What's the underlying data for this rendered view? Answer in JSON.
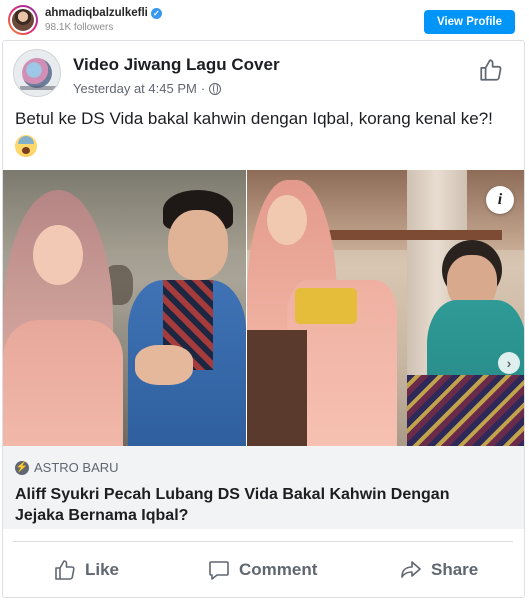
{
  "profile": {
    "username": "ahmadiqbalzulkefli",
    "followers": "98.1K followers",
    "view_profile_label": "View Profile"
  },
  "post": {
    "page_name": "Video Jiwang Lagu Cover",
    "timestamp": "Yesterday at 4:45 PM",
    "separator": "·",
    "text": "Betul ke DS Vida bakal kahwin dengan Iqbal, korang kenal ke?!"
  },
  "link": {
    "source": "ASTRO BARU",
    "headline": "Aliff Syukri Pecah Lubang DS Vida Bakal Kahwin Dengan Jejaka Bernama Iqbal?"
  },
  "actions": {
    "like": "Like",
    "comment": "Comment",
    "share": "Share"
  },
  "icons": {
    "verified": "verified-badge-icon",
    "globe": "globe-icon",
    "thumbs_up": "thumbs-up-icon",
    "info": "info-icon",
    "next": "chevron-right-icon",
    "bolt": "bolt-icon",
    "comment": "comment-icon",
    "share": "share-arrow-icon",
    "emoji": "fearful-face-emoji"
  },
  "colors": {
    "ig_blue": "#0095f6",
    "fb_text": "#1c1e21",
    "fb_secondary": "#606770",
    "link_bg": "#f2f3f5"
  }
}
